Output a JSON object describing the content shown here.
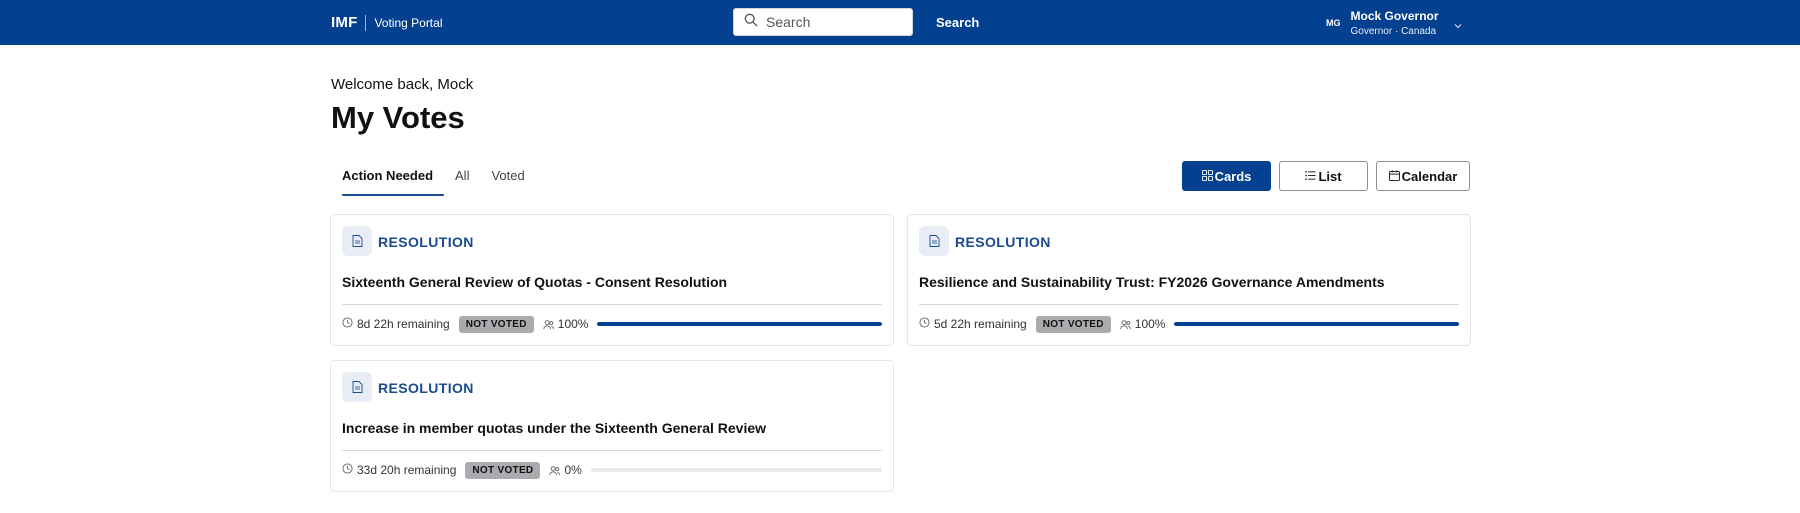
{
  "header": {
    "brand": "IMF",
    "portal_name": "Voting Portal",
    "search_placeholder": "Search",
    "search_button": "Search",
    "user": {
      "initials": "MG",
      "name": "Mock Governor",
      "role": "Governor · Canada"
    }
  },
  "page": {
    "welcome": "Welcome back, Mock",
    "title": "My Votes"
  },
  "tabs": [
    {
      "label": "Action Needed",
      "active": true
    },
    {
      "label": "All",
      "active": false
    },
    {
      "label": "Voted",
      "active": false
    }
  ],
  "views": [
    {
      "label": "Cards",
      "icon": "grid-icon",
      "active": true
    },
    {
      "label": "List",
      "icon": "list-icon",
      "active": false
    },
    {
      "label": "Calendar",
      "icon": "calendar-icon",
      "active": false
    }
  ],
  "cards": [
    {
      "type": "RESOLUTION",
      "title": "Sixteenth General Review of Quotas - Consent Resolution",
      "remaining": "8d 22h remaining",
      "status": "NOT VOTED",
      "participation": "100%",
      "progress": 1.0
    },
    {
      "type": "RESOLUTION",
      "title": "Resilience and Sustainability Trust: FY2026 Governance Amendments",
      "remaining": "5d 22h remaining",
      "status": "NOT VOTED",
      "participation": "100%",
      "progress": 1.0
    },
    {
      "type": "RESOLUTION",
      "title": "Increase in member quotas under the Sixteenth General Review",
      "remaining": "33d 20h remaining",
      "status": "NOT VOTED",
      "participation": "0%",
      "progress": 0.0
    }
  ],
  "colors": {
    "brand_blue": "#03408f",
    "accent_text": "#1a4a8f",
    "badge_gray": "#a9abae"
  }
}
